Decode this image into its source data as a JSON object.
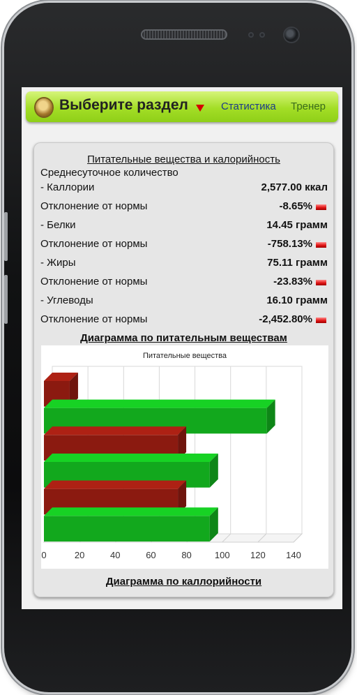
{
  "header": {
    "section_title": "Выберите раздел",
    "tabs": [
      {
        "label": "Статистика"
      },
      {
        "label": "Тренер"
      }
    ]
  },
  "card": {
    "title": "Питательные вещества и калорийность",
    "subheading": "Среднесуточное количество",
    "rows": [
      {
        "label": "- Каллории",
        "value": "2,577.00 ккал",
        "flag": false
      },
      {
        "label": "Отклонение от нормы",
        "value": "-8.65%",
        "flag": true
      },
      {
        "label": "- Белки",
        "value": "14.45 грамм",
        "flag": false
      },
      {
        "label": "Отклонение от нормы",
        "value": "-758.13%",
        "flag": true
      },
      {
        "label": "- Жиры",
        "value": "75.11 грамм",
        "flag": false
      },
      {
        "label": "Отклонение от нормы",
        "value": "-23.83%",
        "flag": true
      },
      {
        "label": "- Углеводы",
        "value": "16.10 грамм",
        "flag": false
      },
      {
        "label": "Отклонение от нормы",
        "value": "-2,452.80%",
        "flag": true
      }
    ],
    "chart_heading": "Диаграмма по питательным веществам",
    "bottom_link": "Диаграмма по каллорийности"
  },
  "colors": {
    "header_green": "#a3de26",
    "bar_dark_red": "#8b1a10",
    "bar_green": "#12a81d",
    "flag_red": "#e01616"
  },
  "chart_data": {
    "type": "bar",
    "orientation": "horizontal",
    "style": "3d",
    "title": "Питательные вещества",
    "xlim": [
      0,
      140
    ],
    "x_ticks": [
      0,
      20,
      40,
      60,
      80,
      100,
      120,
      140
    ],
    "grid": true,
    "series": [
      {
        "color": "#8b1a10",
        "values": [
          14.45,
          75.11,
          75.11
        ]
      },
      {
        "color": "#12a81d",
        "values": [
          125,
          93,
          93
        ]
      }
    ],
    "bars_top_to_bottom": [
      {
        "series": 0,
        "value": 14.45
      },
      {
        "series": 1,
        "value": 125
      },
      {
        "series": 0,
        "value": 75.11
      },
      {
        "series": 1,
        "value": 93
      },
      {
        "series": 0,
        "value": 75.11
      },
      {
        "series": 1,
        "value": 93
      }
    ]
  }
}
